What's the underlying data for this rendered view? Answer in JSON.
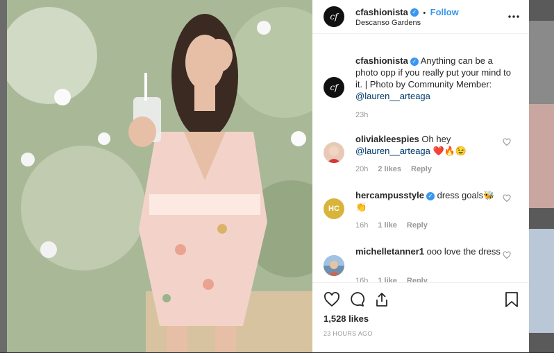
{
  "post": {
    "username": "cfashionista",
    "follow_label": "Follow",
    "separator": "•",
    "location": "Descanso Gardens",
    "logo_text": "cf",
    "more_icon": "ellipsis-icon",
    "verified_icon": "✓"
  },
  "caption": {
    "username": "cfashionista",
    "text": "Anything can be a photo opp if you really put your mind to it. | Photo by Community Member:",
    "mention": "@lauren__arteaga",
    "time": "23h"
  },
  "comments": [
    {
      "username": "oliviakleespies",
      "text": "Oh hey",
      "mention": "@lauren__arteaga",
      "emoji": "❤️🔥😉",
      "time": "20h",
      "likes": "2 likes",
      "reply": "Reply",
      "avatar_color": "#e8c9b8"
    },
    {
      "username": "hercampusstyle",
      "text": "dress goals🐝",
      "emoji": "👏",
      "time": "16h",
      "likes": "1 like",
      "reply": "Reply",
      "avatar_color": "#d9b43a",
      "avatar_text": "HC"
    },
    {
      "username": "michelletanner1",
      "text": "ooo love the dress",
      "time": "16h",
      "likes": "1 like",
      "reply": "Reply",
      "avatar_color": "#6e8fb0"
    }
  ],
  "footer": {
    "likes": "1,528 likes",
    "timestamp": "23 HOURS AGO"
  },
  "colors": {
    "link": "#00376b",
    "accent": "#3897f0",
    "red": "#ed4956"
  }
}
